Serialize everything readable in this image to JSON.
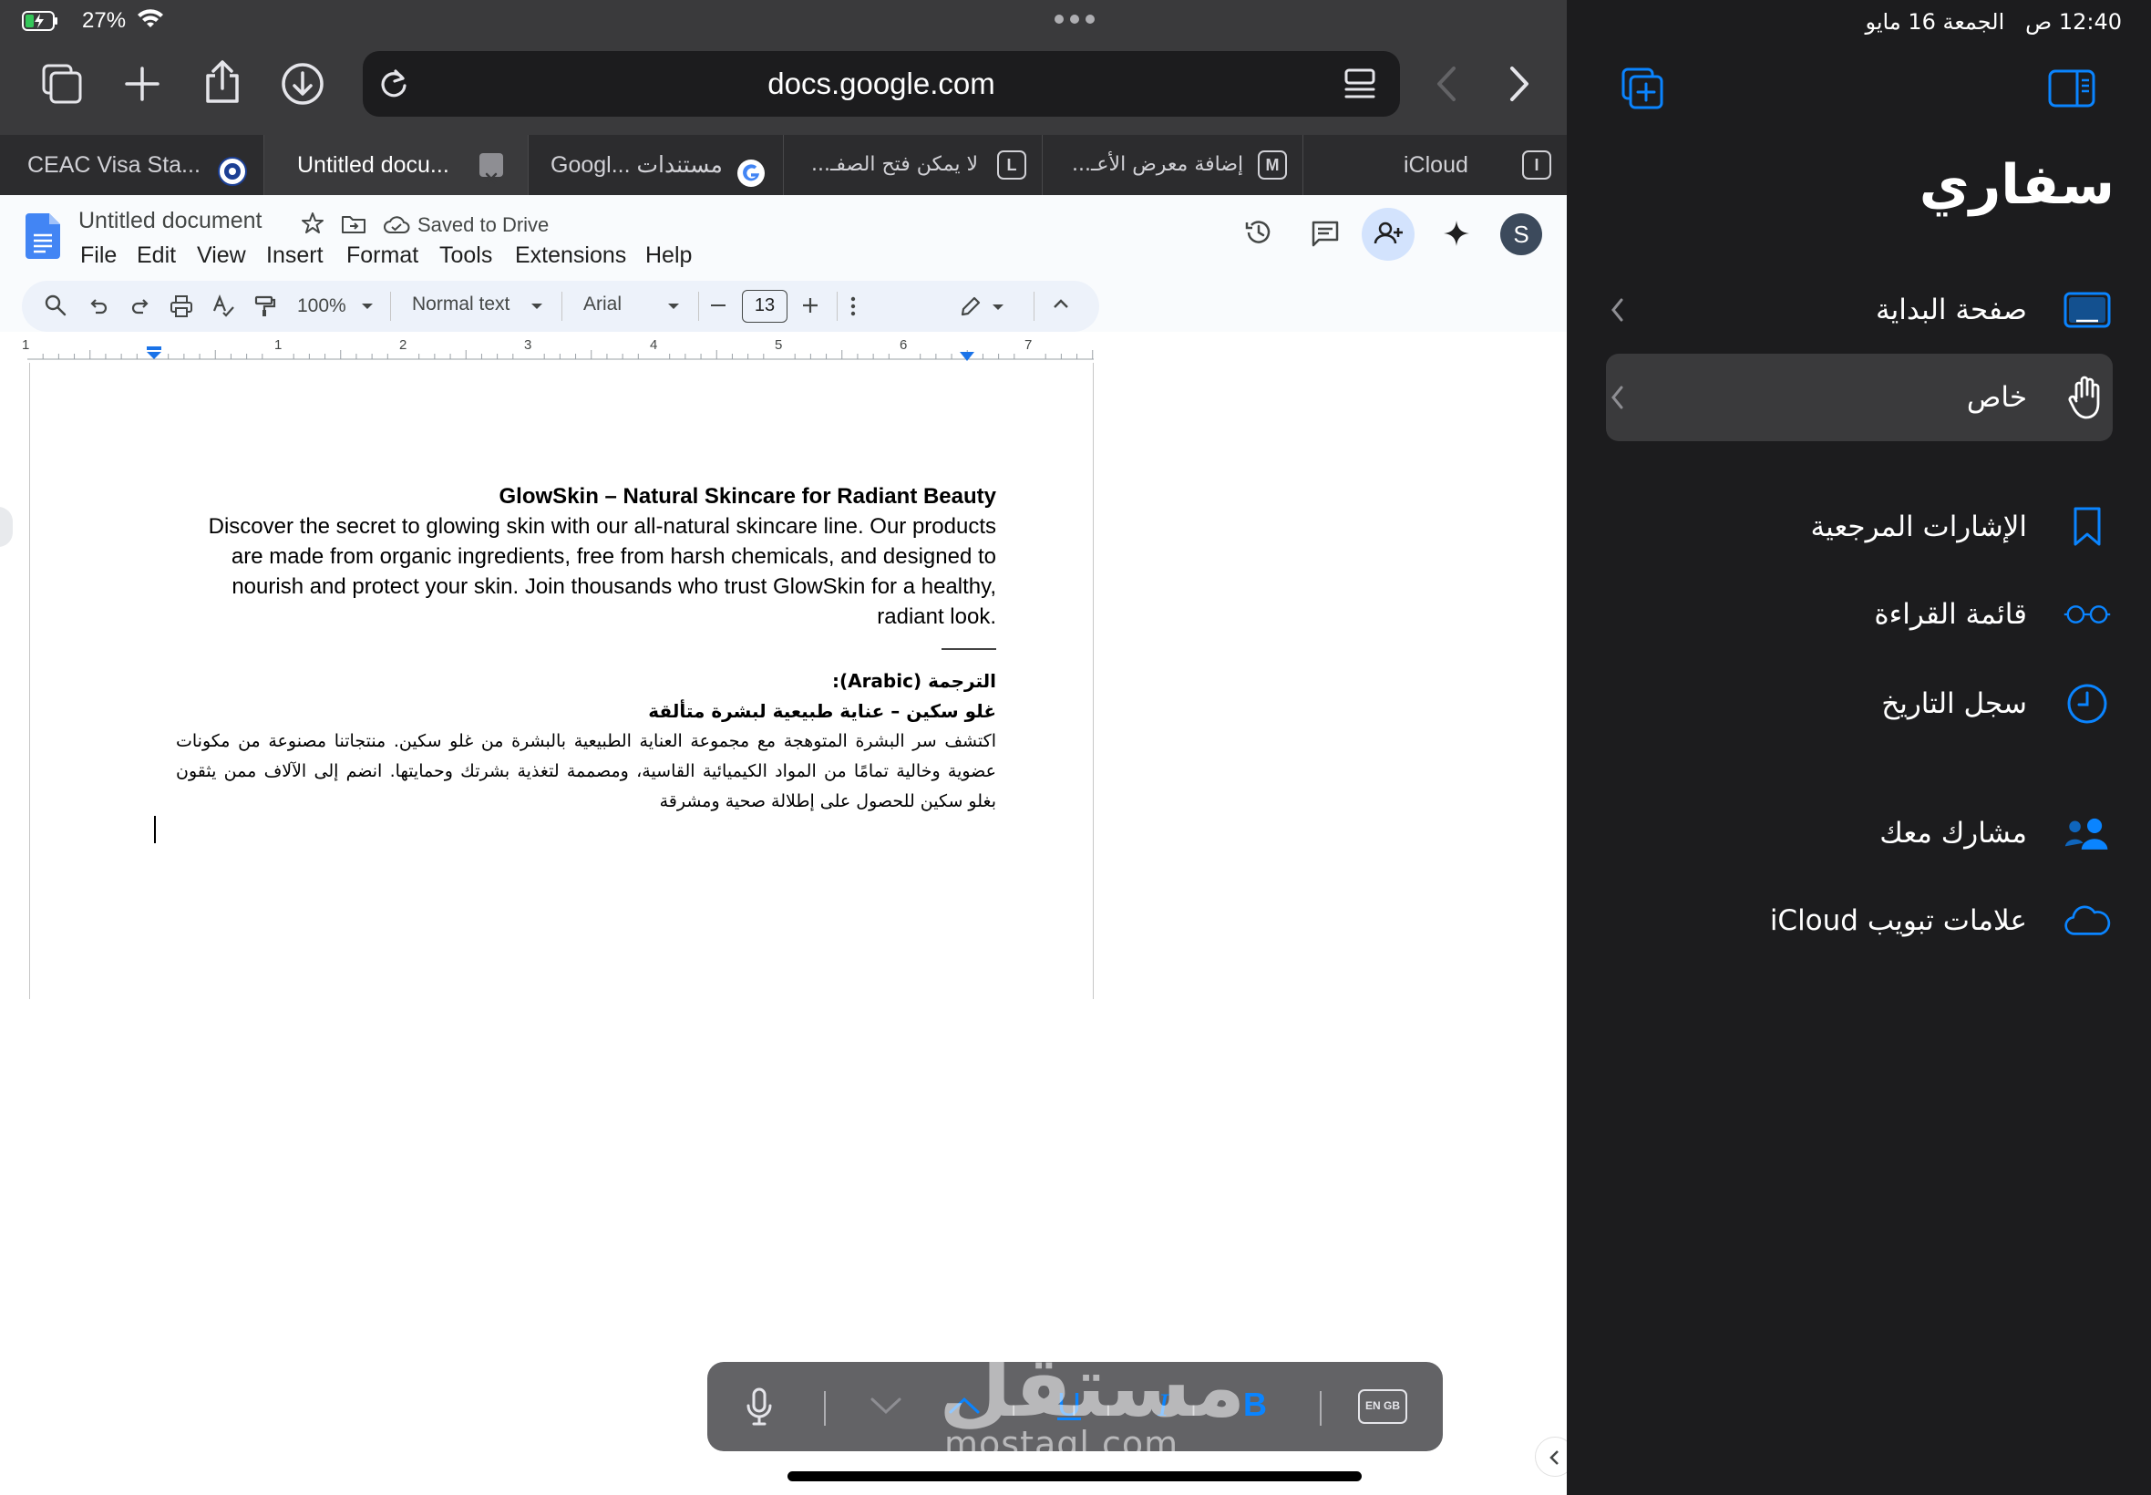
{
  "status": {
    "battery": "27%",
    "time": "12:40 ص",
    "date": "الجمعة 16 مايو"
  },
  "address_bar": {
    "url": "docs.google.com"
  },
  "tabs": [
    {
      "label": "CEAC Visa Sta...",
      "favicon": "seal-icon"
    },
    {
      "label": "Untitled docu...",
      "favicon": "close-icon",
      "active": true
    },
    {
      "label": "مستندات ...Googl",
      "favicon": "google-icon"
    },
    {
      "label": "لا يمكن فتح الصفـ...",
      "favicon": "L"
    },
    {
      "label": "إضافة معرض الأعـ...",
      "favicon": "M"
    },
    {
      "label": "iCloud",
      "favicon": "I"
    }
  ],
  "docs": {
    "title": "Untitled document",
    "saved_status": "Saved to Drive",
    "avatar": "S",
    "menu": [
      "File",
      "Edit",
      "View",
      "Insert",
      "Format",
      "Tools",
      "Extensions",
      "Help"
    ],
    "toolbar": {
      "zoom": "100%",
      "style": "Normal text",
      "font": "Arial",
      "font_size": "13"
    },
    "ruler_marks": [
      "1",
      "1",
      "2",
      "3",
      "4",
      "5",
      "6",
      "7"
    ],
    "content": {
      "heading_en": "GlowSkin – Natural Skincare for Radiant Beauty",
      "para_en": "Discover the secret to glowing skin with our all-natural skincare line. Our products are made from organic ingredients, free from harsh chemicals, and designed to nourish and protect your skin. Join thousands who trust GlowSkin for a healthy, radiant look.",
      "translation_label": "الترجمة (Arabic):",
      "heading_ar": "غلو سكين – عناية طبيعية لبشرة متألقة",
      "para_ar": "اكتشف سر البشرة المتوهجة مع مجموعة العناية الطبيعية بالبشرة من غلو سكين. منتجاتنا مصنوعة من مكونات عضوية وخالية تمامًا من المواد الكيميائية القاسية، ومصممة لتغذية بشرتك وحمايتها. انضم إلى الآلاف ممن يثقون بغلو سكين للحصول على إطلالة صحية ومشرقة"
    }
  },
  "keyboard_bar": {
    "bold": "B",
    "language": "EN GB"
  },
  "watermark": {
    "main": "مستقل",
    "sub": "mostaql.com"
  },
  "sidebar": {
    "title": "سفاري",
    "items": [
      {
        "label": "صفحة البداية",
        "icon": "start-page-icon"
      },
      {
        "label": "خاص",
        "icon": "hand-icon"
      },
      {
        "label": "الإشارات المرجعية",
        "icon": "bookmark-icon"
      },
      {
        "label": "قائمة القراءة",
        "icon": "glasses-icon"
      },
      {
        "label": "سجل التاريخ",
        "icon": "clock-icon"
      },
      {
        "label": "مشارك معك",
        "icon": "shared-people-icon"
      },
      {
        "label": "علامات تبويب iCloud",
        "icon": "cloud-icon"
      }
    ]
  },
  "colors": {
    "accent": "#0a84ff",
    "chrome_dark": "#3a3a3c",
    "sidebar_bg": "#1c1c1e"
  }
}
